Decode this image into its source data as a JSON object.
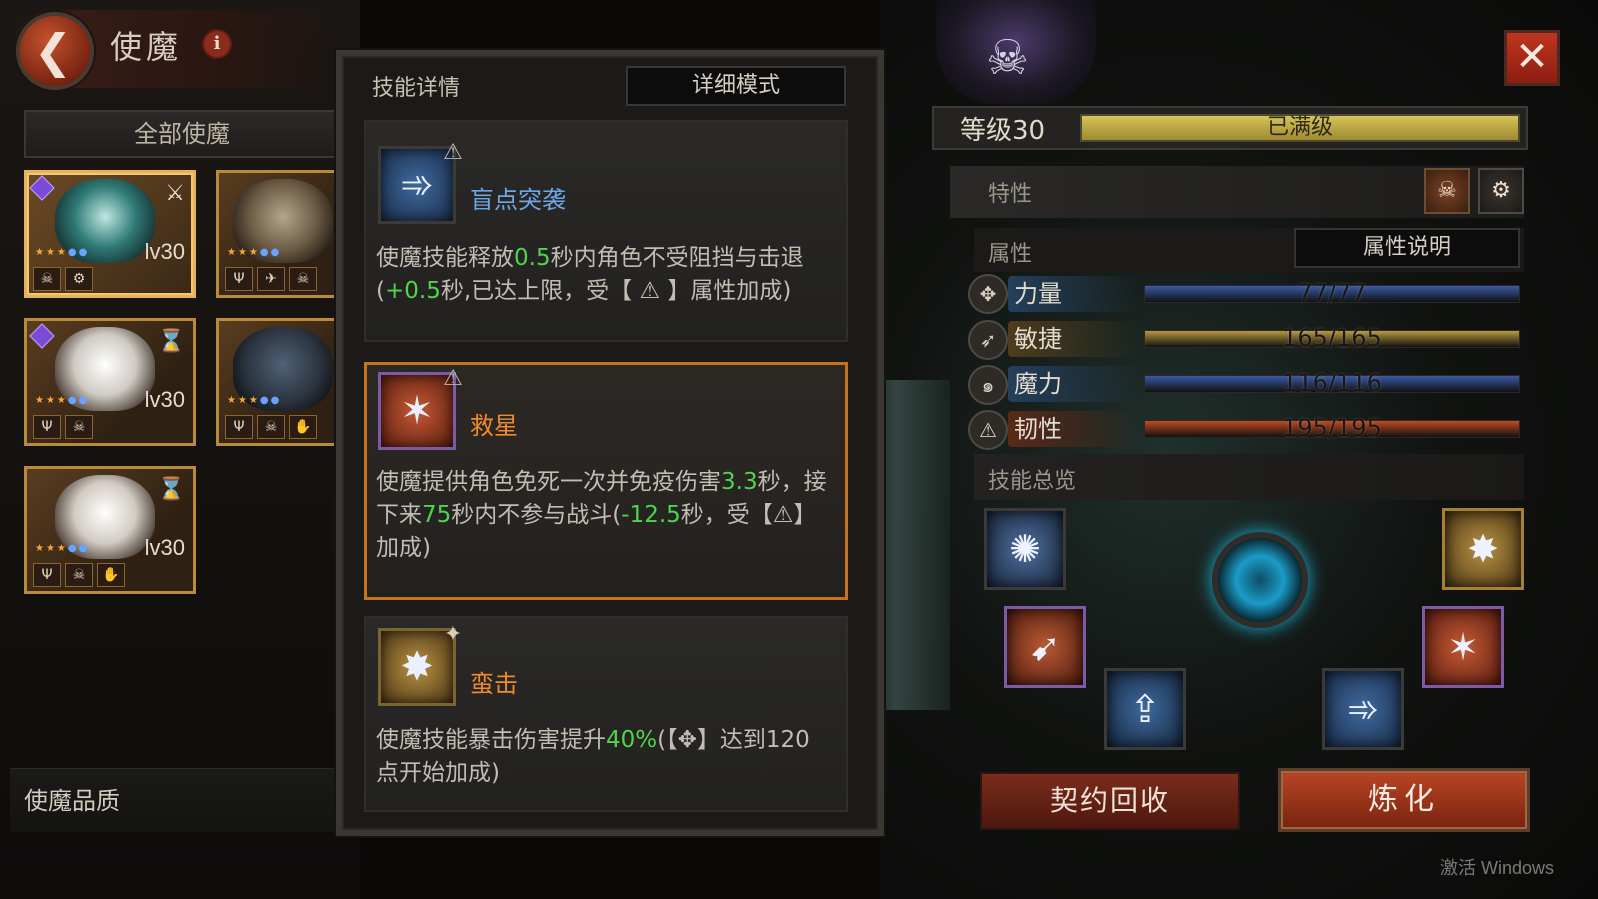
{
  "header": {
    "title": "使魔",
    "info_icon": "i"
  },
  "left_panel": {
    "all_familiars_label": "全部使魔",
    "quality_label": "使魔品质",
    "cards": [
      {
        "level": "lv30",
        "selected": true
      },
      {
        "level": ""
      },
      {
        "level": "lv30"
      },
      {
        "level": ""
      },
      {
        "level": "lv30"
      }
    ]
  },
  "skill_details": {
    "title": "技能详情",
    "mode_button": "详细模式",
    "skills": [
      {
        "name": "盲点突袭",
        "desc_parts": [
          "使魔技能释放",
          "0.5",
          "秒内角色不受阻挡与击退(",
          "+0.5",
          "秒,已达上限，受【",
          "】属性加成)"
        ]
      },
      {
        "name": "救星",
        "desc_parts": [
          "使魔提供角色免死一次并免疫伤害",
          "3.3",
          "秒，接下来",
          "75",
          "秒内不参与战斗(",
          "-12.5",
          "秒，受【",
          "】加成)"
        ]
      },
      {
        "name": "蛮击",
        "desc_parts": [
          "使魔技能暴击伤害提升",
          "40%",
          "(【",
          "】达到120点开始加成)"
        ]
      }
    ]
  },
  "right_panel": {
    "level_label": "等级30",
    "level_status": "已满级",
    "trait_label": "特性",
    "attr_label": "属性",
    "attr_explain_button": "属性说明",
    "stats": [
      {
        "label": "力量",
        "value": "77/77",
        "fill": 1.0,
        "color": "#3a5aa6"
      },
      {
        "label": "敏捷",
        "value": "165/165",
        "fill": 1.0,
        "color": "#b79a3e"
      },
      {
        "label": "魔力",
        "value": "116/116",
        "fill": 1.0,
        "color": "#3a5aa6"
      },
      {
        "label": "韧性",
        "value": "195/195",
        "fill": 1.0,
        "color": "#c24a22"
      }
    ],
    "skills_overview_label": "技能总览",
    "contract_recycle_button": "契约回收",
    "refine_button": "炼化"
  },
  "watermark": "激活 Windows"
}
